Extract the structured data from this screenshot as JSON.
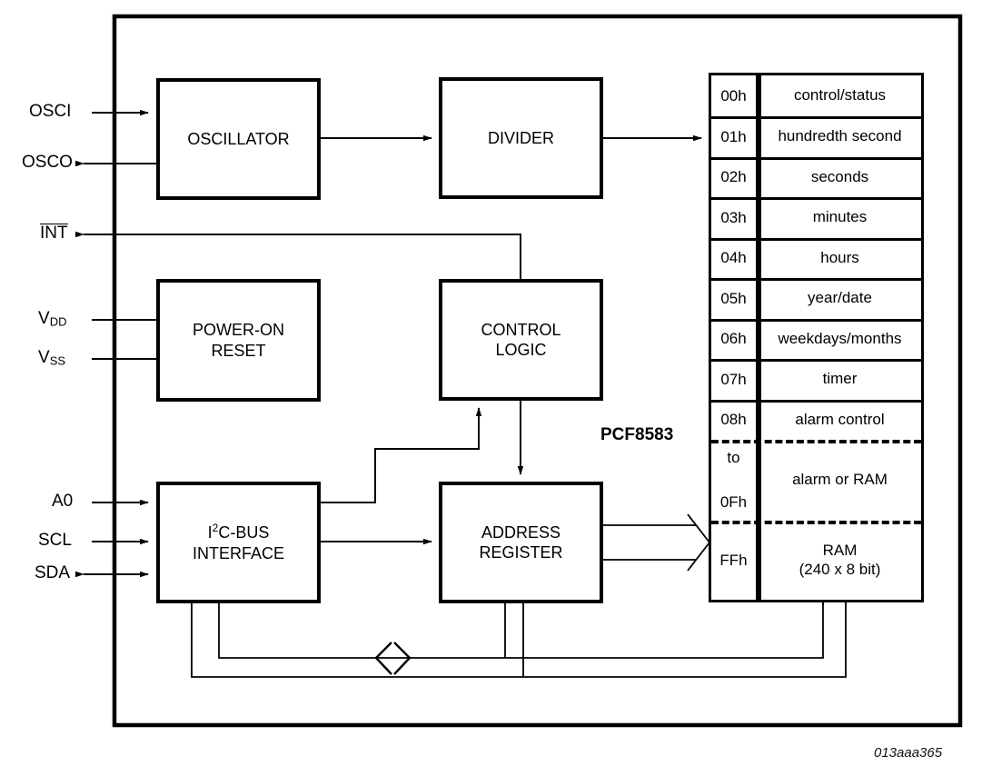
{
  "diagram": {
    "title": "PCF8583 block diagram",
    "part_label": "PCF8583",
    "figure_code": "013aaa365"
  },
  "pins": [
    {
      "name": "OSCI",
      "label": "OSCI",
      "direction": "in"
    },
    {
      "name": "OSCO",
      "label": "OSCO",
      "direction": "out"
    },
    {
      "name": "INT",
      "label": "INT",
      "direction": "out",
      "overline": true
    },
    {
      "name": "VDD",
      "label": "V",
      "sub": "DD",
      "direction": "in"
    },
    {
      "name": "VSS",
      "label": "V",
      "sub": "SS",
      "direction": "in"
    },
    {
      "name": "A0",
      "label": "A0",
      "direction": "in"
    },
    {
      "name": "SCL",
      "label": "SCL",
      "direction": "in"
    },
    {
      "name": "SDA",
      "label": "SDA",
      "direction": "bidir"
    }
  ],
  "blocks": {
    "oscillator": "OSCILLATOR",
    "divider": "DIVIDER",
    "power_on_reset_line1": "POWER-ON",
    "power_on_reset_line2": "RESET",
    "control_logic_line1": "CONTROL",
    "control_logic_line2": "LOGIC",
    "i2c_line1_pre": "I",
    "i2c_line1_sup": "2",
    "i2c_line1_post": "C-BUS",
    "i2c_line2": "INTERFACE",
    "address_register_line1": "ADDRESS",
    "address_register_line2": "REGISTER"
  },
  "register_map": {
    "rows": [
      {
        "addr": "00h",
        "name": "control/status"
      },
      {
        "addr": "01h",
        "name": "hundredth second"
      },
      {
        "addr": "02h",
        "name": "seconds"
      },
      {
        "addr": "03h",
        "name": "minutes"
      },
      {
        "addr": "04h",
        "name": "hours"
      },
      {
        "addr": "05h",
        "name": "year/date"
      },
      {
        "addr": "06h",
        "name": "weekdays/months"
      },
      {
        "addr": "07h",
        "name": "timer"
      },
      {
        "addr": "08h",
        "name": "alarm control"
      }
    ],
    "alarm_block": {
      "addr_top": "to",
      "addr_bottom": "0Fh",
      "name": "alarm or RAM"
    },
    "ram_block": {
      "addr": "FFh",
      "name_line1": "RAM",
      "name_line2": "(240 x 8 bit)"
    }
  },
  "colors": {
    "line": "#000000",
    "background": "#ffffff"
  }
}
